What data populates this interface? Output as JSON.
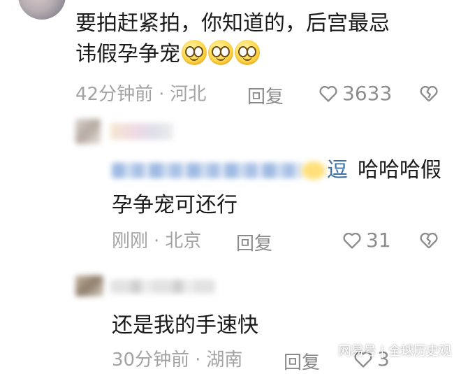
{
  "comment1": {
    "text_line1": "要拍赶紧拍，你知道的，后宫最忌",
    "text_line2": "讳假孕争宠",
    "time": "42分钟前",
    "location": "河北",
    "reply_label": "回复",
    "likes": "3633"
  },
  "reply1": {
    "mention_end": "逗",
    "text_line1_rest": "哈哈哈假",
    "text_line2": "孕争宠可还行",
    "time": "刚刚",
    "location": "北京",
    "reply_label": "回复",
    "likes": "31"
  },
  "reply2": {
    "text": "还是我的手速快",
    "time": "30分钟前",
    "location": "湖南",
    "reply_label": "回复",
    "likes": "3"
  },
  "separator": "·",
  "watermark": "网易号 | 全球历史观",
  "icons": {
    "like": "heart-outline-icon",
    "dislike": "broken-heart-icon",
    "emoji": "smiling-face-emoji"
  }
}
